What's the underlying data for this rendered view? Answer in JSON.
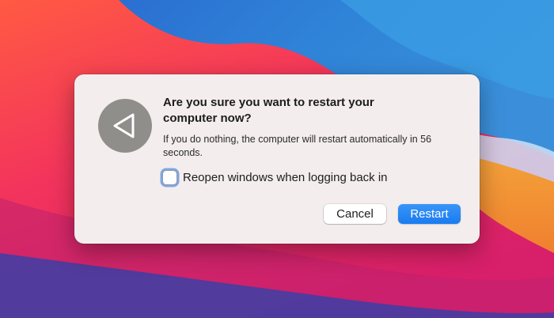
{
  "dialog": {
    "title": "Are you sure you want to restart your computer now?",
    "message": "If you do nothing, the computer will restart automatically in 56 seconds.",
    "checkbox": {
      "label": "Reopen windows when logging back in",
      "checked": false
    },
    "buttons": {
      "cancel": "Cancel",
      "restart": "Restart"
    },
    "icon": "restart-triangle-icon"
  },
  "colors": {
    "dialog_background": "#f3eded",
    "accent_button": "#1a7cf1",
    "icon_circle": "#8f8e8b"
  }
}
